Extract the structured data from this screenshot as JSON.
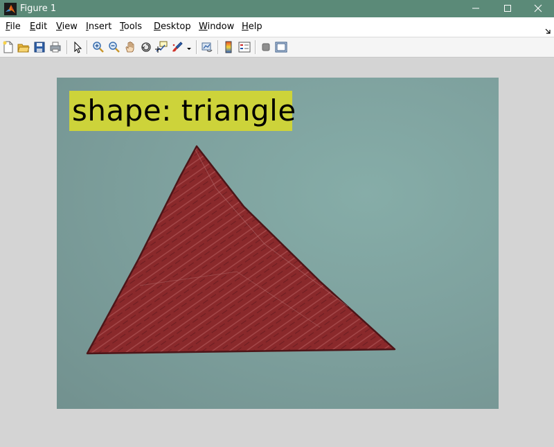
{
  "window": {
    "title": "Figure 1"
  },
  "menu": {
    "items": [
      "File",
      "Edit",
      "View",
      "Insert",
      "Tools",
      "Desktop",
      "Window",
      "Help"
    ]
  },
  "toolbar": {
    "icons": [
      "new-figure-icon",
      "open-file-icon",
      "save-icon",
      "print-icon",
      "edit-plot-pointer-icon",
      "zoom-in-icon",
      "zoom-out-icon",
      "pan-hand-icon",
      "rotate-3d-icon",
      "data-cursor-icon",
      "brush-icon",
      "brush-dropdown-icon",
      "link-plot-icon",
      "insert-colorbar-icon",
      "insert-legend-icon",
      "hide-plot-tools-icon",
      "show-plot-tools-icon"
    ]
  },
  "figure": {
    "annotation": "shape: triangle",
    "colors": {
      "annotation_background": "#cdd33a",
      "triangle_fill": "#8b2a2c",
      "image_background": "#7ea19e"
    }
  }
}
